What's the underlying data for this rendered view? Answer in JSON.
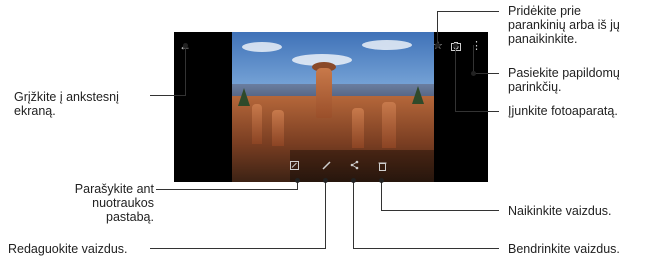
{
  "callouts": {
    "back": "Grįžkite į ankstesnį ekraną.",
    "note": "Parašykite ant nuotraukos pastabą.",
    "edit": "Redaguokite vaizdus.",
    "favorite": "Pridėkite prie parankinių arba iš jų panaikinkite.",
    "more": "Pasiekite papildomų parinkčių.",
    "camera": "Įjunkite fotoaparatą.",
    "delete": "Naikinkite vaizdus.",
    "share": "Bendrinkite vaizdus."
  },
  "icons": {
    "back": "back-arrow-icon",
    "favorite": "star-icon",
    "camera": "camera-icon",
    "more": "more-vertical-icon",
    "note": "note-icon",
    "edit": "pencil-icon",
    "share": "share-icon",
    "delete": "trash-icon"
  }
}
